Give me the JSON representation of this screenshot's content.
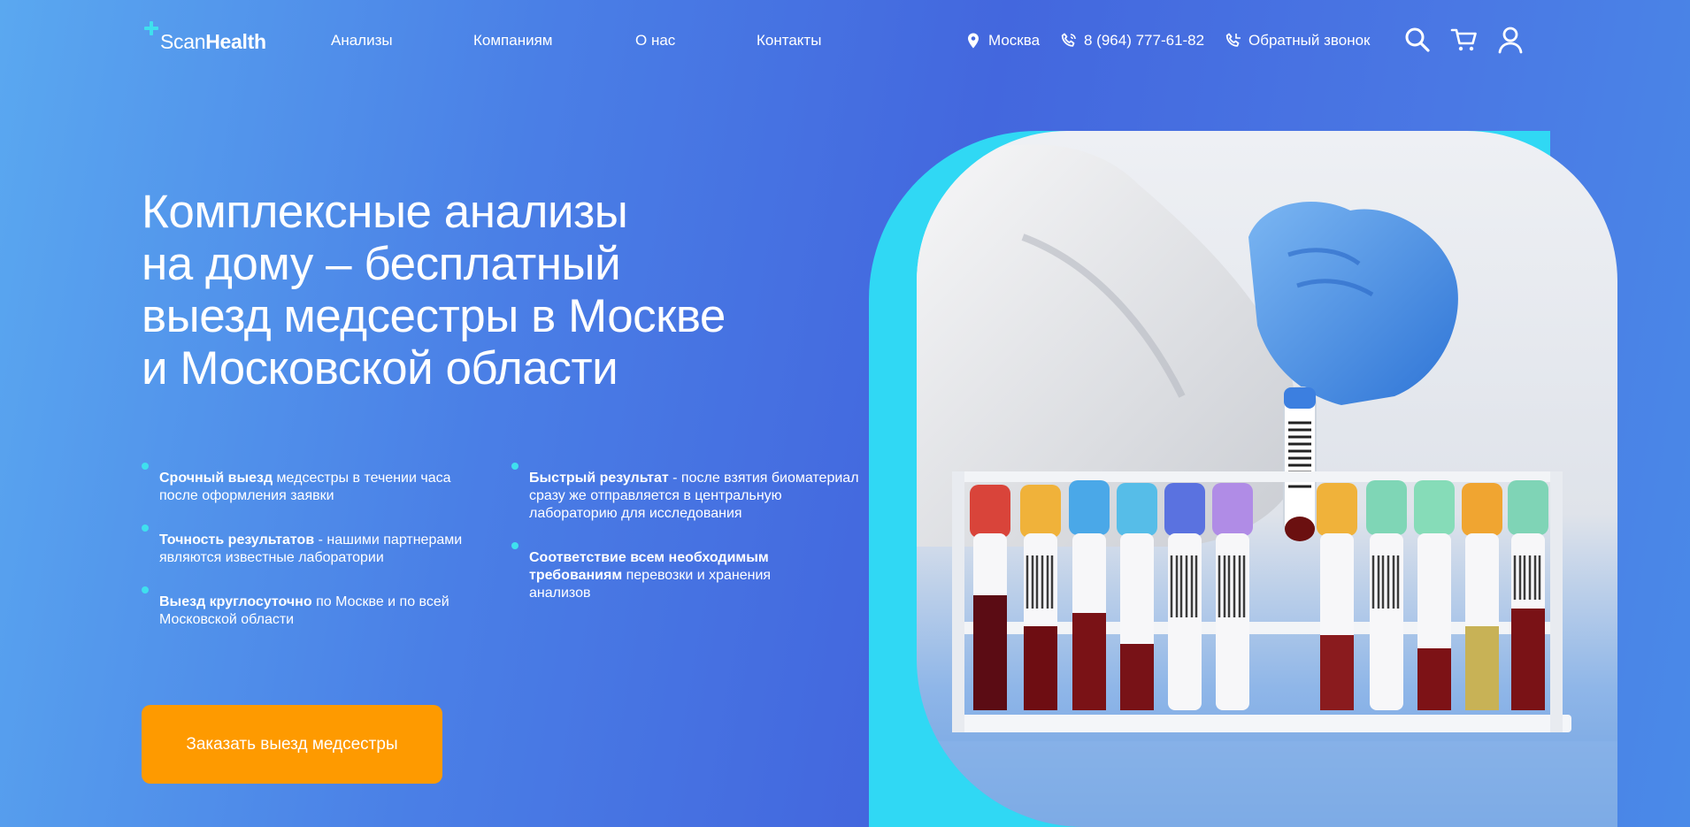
{
  "header": {
    "logo": {
      "scan": "Scan",
      "health": "Health"
    },
    "nav": [
      {
        "label": "Анализы"
      },
      {
        "label": "Компаниям"
      },
      {
        "label": "О нас"
      },
      {
        "label": "Контакты"
      }
    ],
    "city": "Москва",
    "phone": "8 (964) 777-61-82",
    "callback": "Обратный звонок",
    "icons": [
      "location-pin-icon",
      "phone-icon",
      "callback-phone-icon",
      "search-icon",
      "cart-icon",
      "user-icon"
    ]
  },
  "hero": {
    "title_lines": [
      "Комплексные анализы",
      "на дому – бесплатный",
      "выезд медсестры в Москве",
      "и Московской области"
    ],
    "features_left": [
      {
        "bold": "Срочный выезд",
        "text": " медсестры в течении часа после оформления заявки"
      },
      {
        "bold": "Точность результатов",
        "text": " - нашими партнерами являются известные лаборатории"
      },
      {
        "bold": "Выезд круглосуточно",
        "text": " по Москве и по всей Московской области"
      }
    ],
    "features_right": [
      {
        "bold": "Быстрый результат",
        "text": " - после взятия биоматериал сразу же отправляется в центральную лабораторию для исследования"
      },
      {
        "bold": "Соответствие всем необходимым требованиям",
        "text": " перевозки и хранения анализов"
      }
    ],
    "cta_label": "Заказать выезд медсестры"
  },
  "colors": {
    "accent_cyan": "#3fe0ee",
    "cta_orange": "#fe9a00",
    "background_blue": "#4367de"
  },
  "image": {
    "subject": "lab-test-tubes-photo"
  }
}
